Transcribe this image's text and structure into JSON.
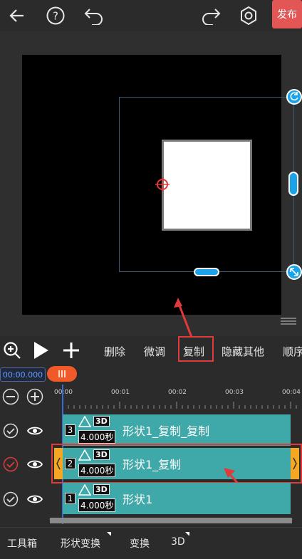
{
  "topbar": {
    "publish_label": "发布"
  },
  "toolbar": {
    "items": [
      "删除",
      "微调",
      "复制",
      "隐藏其他",
      "顺序"
    ]
  },
  "timeline": {
    "current_time": "00:00.000",
    "ruler_ticks": [
      "00:00",
      "00:01",
      "00:02",
      "00:03",
      "00:04"
    ]
  },
  "tracks": [
    {
      "index": "3",
      "duration": "4.000秒",
      "name": "形状1_复制_复制",
      "selected": false
    },
    {
      "index": "2",
      "duration": "4.000秒",
      "name": "形状1_复制",
      "selected": true
    },
    {
      "index": "1",
      "duration": "4.000秒",
      "name": "形状1",
      "selected": false
    }
  ],
  "badges": {
    "three_d": "3D"
  },
  "bottom_tabs": [
    "工具箱",
    "形状变换",
    "变换",
    "3D"
  ],
  "colors": {
    "accent": "#1aa3e8",
    "publish": "#e35656",
    "clip": "#3fa8a8",
    "highlight": "#e03a3a",
    "handle": "#f5a623"
  }
}
